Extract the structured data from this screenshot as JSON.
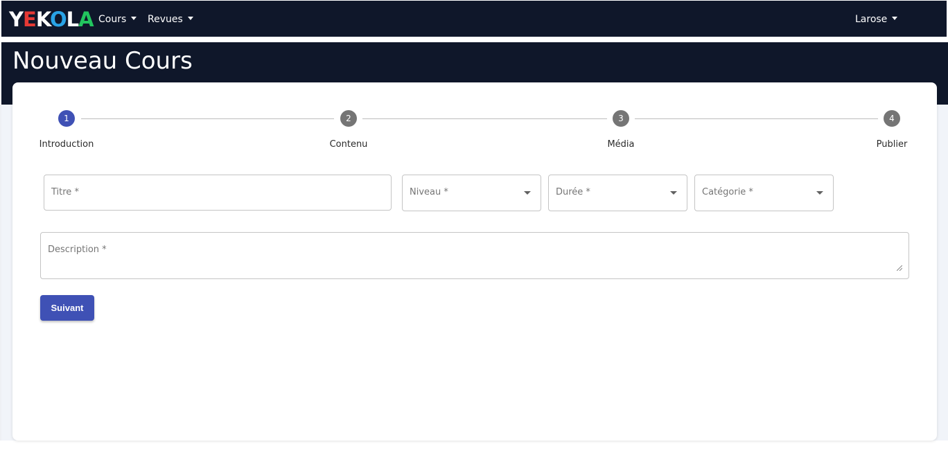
{
  "navbar": {
    "logo_letters": [
      {
        "char": "Y",
        "color": "#ffffff"
      },
      {
        "char": "E",
        "color": "#e53935"
      },
      {
        "char": "K",
        "color": "#ffffff"
      },
      {
        "char": "O",
        "color": "#29a3e6"
      },
      {
        "char": "L",
        "color": "#ffffff"
      },
      {
        "char": "A",
        "color": "#22c55e"
      }
    ],
    "menu": [
      {
        "label": "Cours"
      },
      {
        "label": "Revues"
      }
    ],
    "user_menu": {
      "label": "Larose"
    }
  },
  "page": {
    "title": "Nouveau Cours"
  },
  "stepper": {
    "active_color": "#3f51b5",
    "inactive_color": "#757575",
    "steps": [
      {
        "number": "1",
        "label": "Introduction",
        "active": true
      },
      {
        "number": "2",
        "label": "Contenu",
        "active": false
      },
      {
        "number": "3",
        "label": "Média",
        "active": false
      },
      {
        "number": "4",
        "label": "Publier",
        "active": false
      }
    ]
  },
  "form": {
    "title_field": {
      "label": "Titre *",
      "value": ""
    },
    "level_select": {
      "label": "Niveau *",
      "value": ""
    },
    "duration_select": {
      "label": "Durée *",
      "value": ""
    },
    "category_select": {
      "label": "Catégorie *",
      "value": ""
    },
    "description_field": {
      "label": "Description *",
      "value": ""
    },
    "next_button": {
      "label": "Suivant"
    }
  },
  "colors": {
    "navbar_bg": "#0f172a",
    "primary": "#3f51b5"
  }
}
